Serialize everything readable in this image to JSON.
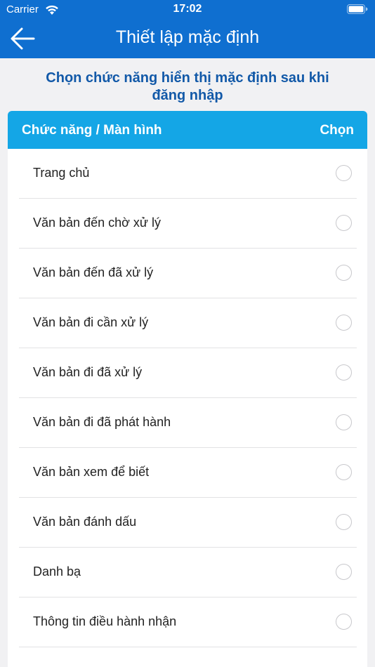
{
  "status_bar": {
    "carrier": "Carrier",
    "time": "17:02"
  },
  "nav": {
    "title": "Thiết lập mặc định",
    "back_icon": "arrow-left-icon"
  },
  "subtitle": "Chọn chức năng hiển thị mặc định sau khi đăng nhập",
  "table": {
    "header_function": "Chức năng / Màn hình",
    "header_select": "Chọn",
    "rows": [
      {
        "label": "Trang chủ",
        "selected": false
      },
      {
        "label": "Văn bản đến chờ xử lý",
        "selected": false
      },
      {
        "label": "Văn bản đến đã xử lý",
        "selected": false
      },
      {
        "label": "Văn bản đi cần xử lý",
        "selected": false
      },
      {
        "label": "Văn bản đi đã xử lý",
        "selected": false
      },
      {
        "label": "Văn bản đi đã phát hành",
        "selected": false
      },
      {
        "label": "Văn bản xem để biết",
        "selected": false
      },
      {
        "label": "Văn bản đánh dấu",
        "selected": false
      },
      {
        "label": "Danh bạ",
        "selected": false
      },
      {
        "label": "Thông tin điều hành nhận",
        "selected": false
      }
    ]
  },
  "colors": {
    "nav_bg": "#0f6fd0",
    "header_bg": "#14a6e6",
    "subtitle": "#1259a8"
  }
}
